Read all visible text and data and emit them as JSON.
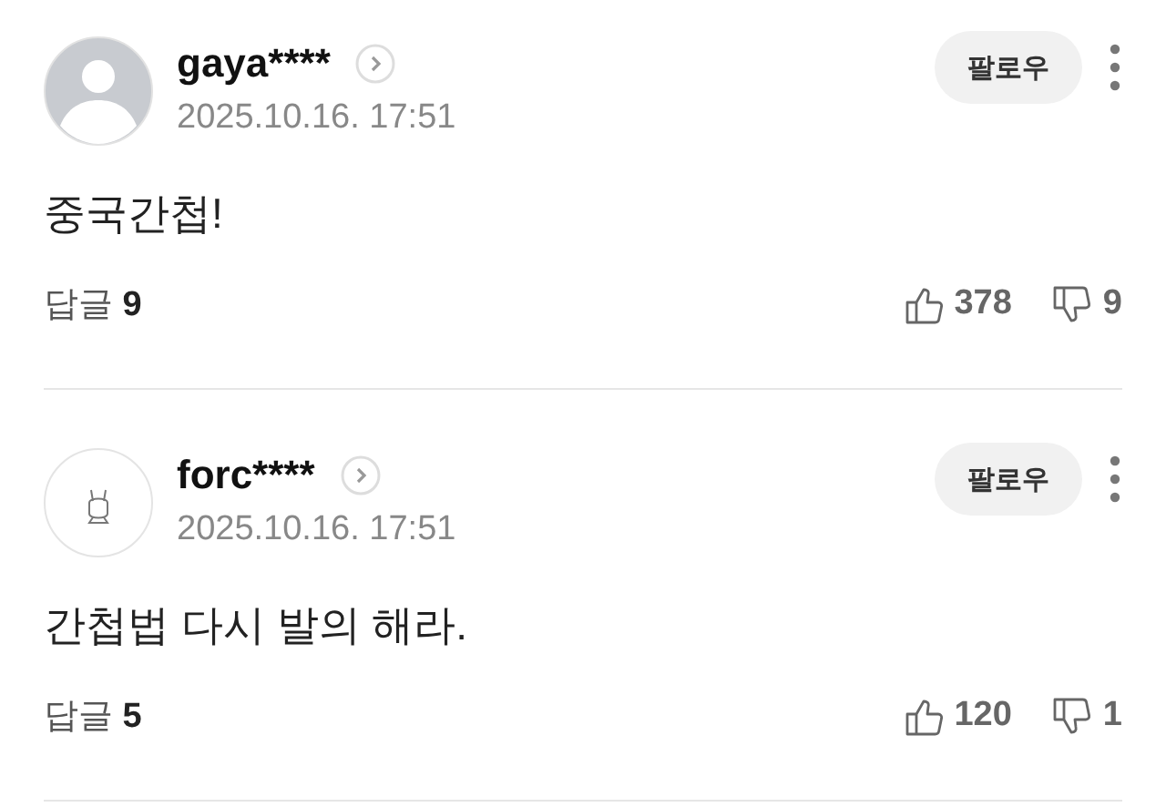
{
  "comments": [
    {
      "avatar": {
        "kind": "default"
      },
      "username": "gaya****",
      "date": "2025.10.16. 17:51",
      "follow": "팔로우",
      "text": "중국간첩!",
      "reply_label": "답글",
      "reply_count": "9",
      "likes": "378",
      "dislikes": "9"
    },
    {
      "avatar": {
        "kind": "custom"
      },
      "username": "forc****",
      "date": "2025.10.16. 17:51",
      "follow": "팔로우",
      "text": "간첩법 다시 발의 해라.",
      "reply_label": "답글",
      "reply_count": "5",
      "likes": "120",
      "dislikes": "1"
    }
  ]
}
